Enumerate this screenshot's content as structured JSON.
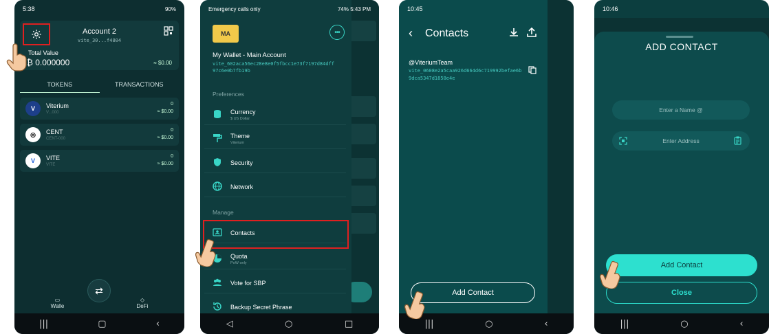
{
  "colors": {
    "accent": "#2de0cf",
    "highlight": "#e02020",
    "address": "#46c9bf"
  },
  "phone1": {
    "status": {
      "time": "5:38",
      "right": "90%"
    },
    "account": {
      "name": "Account 2",
      "address": "vite_30...f4804"
    },
    "total_value_label": "Total Value",
    "total_value": "0.000000",
    "total_usd": "≈ $0.00",
    "tabs": [
      "TOKENS",
      "TRANSACTIONS"
    ],
    "tokens": [
      {
        "name": "Viterium",
        "sub": "V...000",
        "balance": "0",
        "usd": "≈ $0.00",
        "icon": "V"
      },
      {
        "name": "CENT",
        "sub": "CENT-000",
        "balance": "0",
        "usd": "≈ $0.00",
        "icon": "◎"
      },
      {
        "name": "VITE",
        "sub": "VITE",
        "balance": "0",
        "usd": "≈ $0.00",
        "icon": "V"
      }
    ],
    "bottom_nav": {
      "wallet": "Walle",
      "defi": "DeFi"
    }
  },
  "phone2": {
    "status": {
      "left": "Emergency calls only",
      "right": "74%",
      "time": "5:43 PM"
    },
    "wallet_icon_text": "MA",
    "wallet_title": "My Wallet - Main Account",
    "wallet_address": "vite_602aca56ec28e8e0f5fbcc1e73f7197d84dff97c6e0b7fb19b",
    "sections": {
      "preferences": "Preferences",
      "manage": "Manage"
    },
    "menu": [
      {
        "label": "Currency",
        "sub": "$ US Dollar"
      },
      {
        "label": "Theme",
        "sub": "Viterium"
      },
      {
        "label": "Security",
        "sub": ""
      },
      {
        "label": "Network",
        "sub": ""
      },
      {
        "label": "Contacts",
        "sub": ""
      },
      {
        "label": "Quota",
        "sub": "PoW only"
      },
      {
        "label": "Vote for SBP",
        "sub": ""
      },
      {
        "label": "Backup Secret Phrase",
        "sub": ""
      }
    ]
  },
  "phone3": {
    "status": {
      "time": "10:45"
    },
    "title": "Contacts",
    "contact": {
      "name": "@ViteriumTeam",
      "address": "vite_0608e2a5caa926d664d6c719992befae6b9dca5347d1858e4e"
    },
    "add_button": "Add Contact"
  },
  "phone4": {
    "status": {
      "time": "10:46"
    },
    "title": "ADD CONTACT",
    "name_placeholder": "Enter a Name @",
    "address_placeholder": "Enter Address",
    "add_button": "Add Contact",
    "close_button": "Close"
  }
}
